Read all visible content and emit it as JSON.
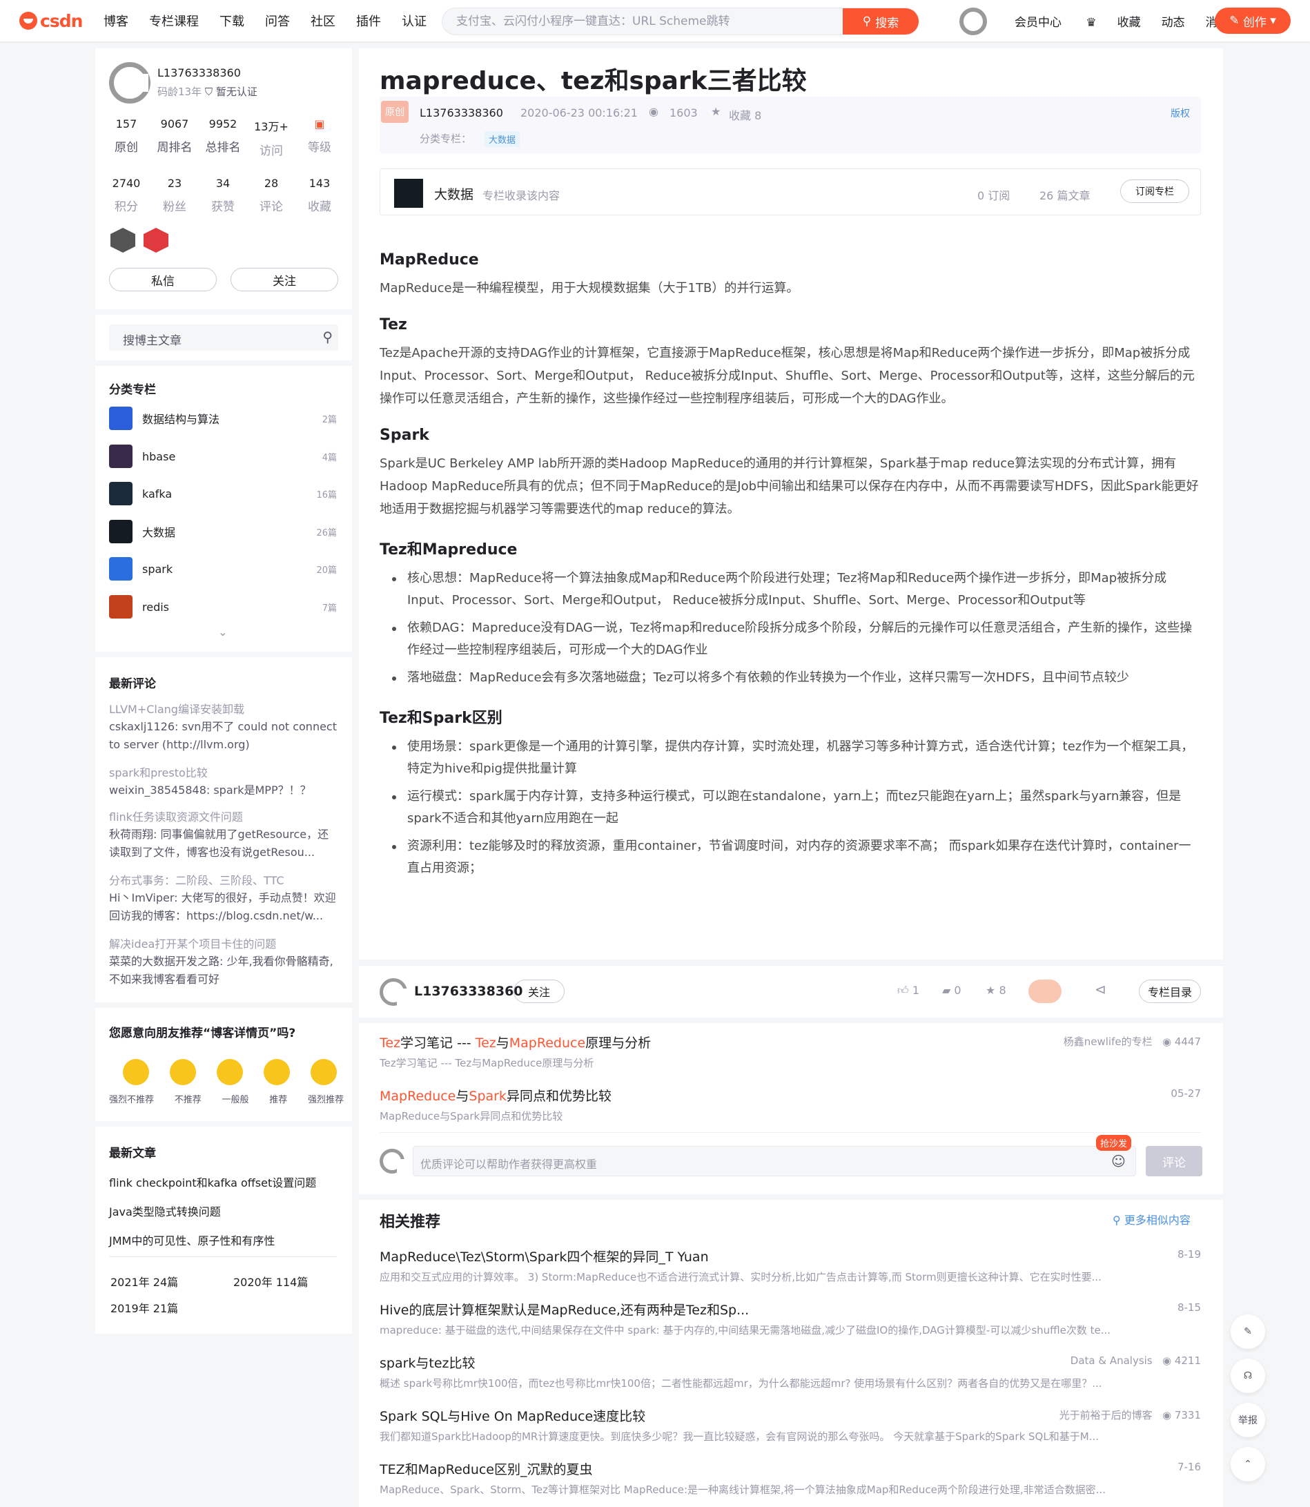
{
  "header": {
    "logo": "csdn",
    "nav": [
      "博客",
      "专栏课程",
      "下载",
      "问答",
      "社区",
      "插件",
      "认证"
    ],
    "search_placeholder": "支付宝、云闪付小程序一键直达：URL Scheme跳转",
    "search_btn": "搜索",
    "right": [
      "会员中心",
      "收藏",
      "动态",
      "消息"
    ],
    "create": "创作"
  },
  "profile": {
    "name": "L13763338360",
    "age": "码龄13年",
    "verify": "暂无认证",
    "stats1": [
      {
        "n": "157",
        "l": "原创"
      },
      {
        "n": "9067",
        "l": "周排名"
      },
      {
        "n": "9952",
        "l": "总排名"
      },
      {
        "n": "13万+",
        "l": "访问"
      },
      {
        "n": "",
        "l": "等级"
      }
    ],
    "stats2": [
      {
        "n": "2740",
        "l": "积分"
      },
      {
        "n": "23",
        "l": "粉丝"
      },
      {
        "n": "34",
        "l": "获赞"
      },
      {
        "n": "28",
        "l": "评论"
      },
      {
        "n": "143",
        "l": "收藏"
      }
    ],
    "msg_btn": "私信",
    "follow_btn": "关注"
  },
  "blog_search": {
    "placeholder": "搜博主文章"
  },
  "columns": {
    "title": "分类专栏",
    "items": [
      {
        "t": "数据结构与算法",
        "c": "2篇",
        "color": "#2a5fd9"
      },
      {
        "t": "hbase",
        "c": "4篇",
        "color": "#3a2a4a"
      },
      {
        "t": "kafka",
        "c": "16篇",
        "color": "#1a2a3a"
      },
      {
        "t": "大数据",
        "c": "26篇",
        "color": "#151b22"
      },
      {
        "t": "spark",
        "c": "20篇",
        "color": "#2a6fe0"
      },
      {
        "t": "redis",
        "c": "7篇",
        "color": "#c2411a"
      }
    ]
  },
  "comments": {
    "title": "最新评论",
    "items": [
      {
        "t": "LLVM+Clang编译安装卸载",
        "b": "cskaxlj1126: svn用不了 could not connect to server (http://llvm.org)"
      },
      {
        "t": "spark和presto比较",
        "b": "weixin_38545848: spark是MPP？！？"
      },
      {
        "t": "flink任务读取资源文件问题",
        "b": "秋荷雨翔: 同事偏偏就用了getResource，还读取到了文件，博客也没有说getResou..."
      },
      {
        "t": "分布式事务：二阶段、三阶段、TTC",
        "b": "Hi丶ImViper: 大佬写的很好，手动点赞！欢迎回访我的博客：https://blog.csdn.net/w..."
      },
      {
        "t": "解决idea打开某个项目卡住的问题",
        "b": "菜菜的大数据开发之路: 少年,我看你骨骼精奇,不如来我博客看看可好"
      }
    ]
  },
  "survey": {
    "title": "您愿意向朋友推荐“博客详情页”吗?",
    "opts": [
      "强烈不推荐",
      "不推荐",
      "一般般",
      "推荐",
      "强烈推荐"
    ]
  },
  "latest": {
    "title": "最新文章",
    "items": [
      "flink checkpoint和kafka offset设置问题",
      "Java类型隐式转换问题",
      "JMM中的可见性、原子性和有序性"
    ],
    "archive": [
      "2021年 24篇",
      "2020年 114篇",
      "2019年 21篇"
    ]
  },
  "article": {
    "title": "mapreduce、tez和spark三者比较",
    "badge": "原创",
    "author": "L13763338360",
    "date": "2020-06-23 00:16:21",
    "views": "1603",
    "fav": "收藏 8",
    "copyright": "版权",
    "cat_label": "分类专栏：",
    "cat": "大数据",
    "column_box": {
      "name": "大数据",
      "desc": "专栏收录该内容",
      "subs": "0 订阅",
      "count": "26 篇文章",
      "btn": "订阅专栏"
    },
    "s1_h": "MapReduce",
    "s1_p": "MapReduce是一种编程模型，用于大规模数据集（大于1TB）的并行运算。",
    "s2_h": "Tez",
    "s2_p": "Tez是Apache开源的支持DAG作业的计算框架，它直接源于MapReduce框架，核心思想是将Map和Reduce两个操作进一步拆分，即Map被拆分成Input、Processor、Sort、Merge和Output， Reduce被拆分成Input、Shuffle、Sort、Merge、Processor和Output等，这样，这些分解后的元操作可以任意灵活组合，产生新的操作，这些操作经过一些控制程序组装后，可形成一个大的DAG作业。",
    "s3_h": "Spark",
    "s3_p": "Spark是UC Berkeley AMP lab所开源的类Hadoop MapReduce的通用的并行计算框架，Spark基于map reduce算法实现的分布式计算，拥有Hadoop MapReduce所具有的优点；但不同于MapReduce的是Job中间输出和结果可以保存在内存中，从而不再需要读写HDFS，因此Spark能更好地适用于数据挖掘与机器学习等需要迭代的map reduce的算法。",
    "s4_h": "Tez和Mapreduce",
    "s4_li": [
      "核心思想：MapReduce将一个算法抽象成Map和Reduce两个阶段进行处理；Tez将Map和Reduce两个操作进一步拆分，即Map被拆分成Input、Processor、Sort、Merge和Output， Reduce被拆分成Input、Shuffle、Sort、Merge、Processor和Output等",
      "依赖DAG：Mapreduce没有DAG一说，Tez将map和reduce阶段拆分成多个阶段，分解后的元操作可以任意灵活组合，产生新的操作，这些操作经过一些控制程序组装后，可形成一个大的DAG作业",
      "落地磁盘：MapReduce会有多次落地磁盘；Tez可以将多个有依赖的作业转换为一个作业，这样只需写一次HDFS，且中间节点较少"
    ],
    "s5_h": "Tez和Spark区别",
    "s5_li": [
      "使用场景：spark更像是一个通用的计算引擎，提供内存计算，实时流处理，机器学习等多种计算方式，适合迭代计算；tez作为一个框架工具，特定为hive和pig提供批量计算",
      "运行模式：spark属于内存计算，支持多种运行模式，可以跑在standalone，yarn上；而tez只能跑在yarn上；虽然spark与yarn兼容，但是spark不适合和其他yarn应用跑在一起",
      "资源利用：tez能够及时的释放资源，重用container，节省调度时间，对内存的资源要求率不高； 而spark如果存在迭代计算时，container一直占用资源；"
    ]
  },
  "bottom_bar": {
    "author": "L13763338360",
    "follow": "关注",
    "like": "1",
    "comment": "0",
    "star": "8",
    "catalog": "专栏目录"
  },
  "links": [
    {
      "t1": "Tez",
      "t2": "学习笔记 --- ",
      "t3": "Tez",
      "t4": "与",
      "t5": "MapReduce",
      "t6": "原理与分析",
      "d": "Tez学习笔记 --- Tez与MapReduce原理与分析",
      "r": "杨鑫newlife的专栏",
      "v": "4447"
    },
    {
      "t1": "MapReduce",
      "t2": "与",
      "t3": "Spark",
      "t4": "异同点和优势比较",
      "t5": "",
      "t6": "",
      "d": "MapReduce与Spark异同点和优势比较",
      "r": "",
      "v": "05-27"
    }
  ],
  "comment_box": {
    "placeholder": "优质评论可以帮助作者获得更高权重",
    "tag": "抢沙发",
    "btn": "评论"
  },
  "related": {
    "title": "相关推荐",
    "more": "更多相似内容",
    "items": [
      {
        "t": "MapReduce\\Tez\\Storm\\Spark四个框架的异同_T Yuan",
        "d": "应用和交互式应用的计算效率。 3) Storm:MapReduce也不适合进行流式计算、实时分析,比如广告点击计算等,而 Storm则更擅长这种计算、它在实时性要...",
        "r": "8-19"
      },
      {
        "t": "Hive的底层计算框架默认是MapReduce,还有两种是Tez和Sp...",
        "d": "mapreduce: 基于磁盘的迭代,中间结果保存在文件中 spark: 基于内存的,中间结果无需落地磁盘,减少了磁盘IO的操作,DAG计算模型-可以减少shuffle次数 te...",
        "r": "8-15"
      },
      {
        "t": "spark与tez比较",
        "d": "概述 spark号称比mr快100倍，而tez也号称比mr快100倍；二者性能都远超mr，为什么都能远超mr? 使用场景有什么区别？两者各自的优势又是在哪里？...",
        "r": "Data & Analysis",
        "v": "4211"
      },
      {
        "t": "Spark SQL与Hive On MapReduce速度比较",
        "d": "我们都知道Spark比Hadoop的MR计算速度更快。到底快多少呢？我一直比较疑惑，会有官网说的那么夸张吗。 今天就拿基于Spark的Spark SQL和基于M...",
        "r": "光于前裕于后的博客",
        "v": "7331"
      },
      {
        "t": "TEZ和MapReduce区别_沉默的夏虫",
        "d": "MapReduce、Spark、Storm、Tez等计算框架对比 MapReduce:是一种离线计算框架,将一个算法抽象成Map和Reduce两个阶段进行处理,非常适合数据密...",
        "r": "7-16"
      }
    ]
  },
  "side_tools": {
    "report": "举报"
  }
}
